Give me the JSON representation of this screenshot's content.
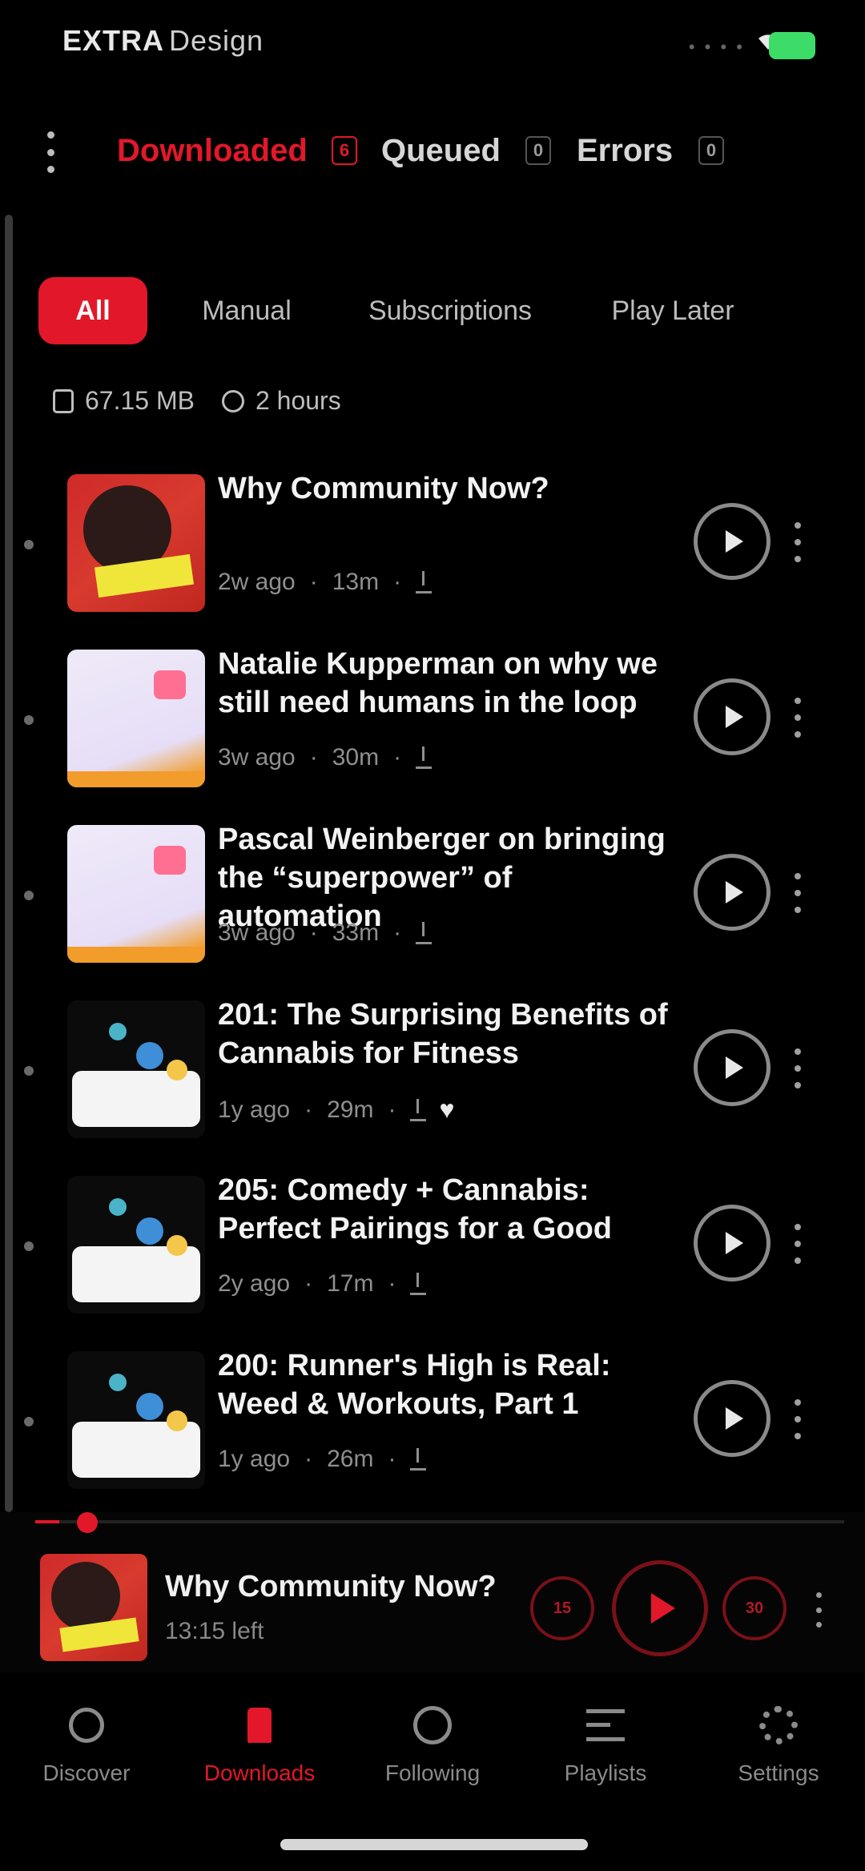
{
  "status_bar": {
    "carrier_bold": "EXTRA",
    "carrier_rest": "Design",
    "signal": "• • • •"
  },
  "top_tabs": [
    {
      "label": "Downloaded",
      "badge": "6",
      "active": true
    },
    {
      "label": "Queued",
      "badge": "0",
      "active": false
    },
    {
      "label": "Errors",
      "badge": "0",
      "active": false
    }
  ],
  "filters": [
    {
      "label": "All",
      "active": true
    },
    {
      "label": "Manual",
      "active": false
    },
    {
      "label": "Subscriptions",
      "active": false
    },
    {
      "label": "Play Later",
      "active": false
    }
  ],
  "summary": {
    "size": "67.15 MB",
    "duration": "2 hours"
  },
  "episodes": [
    {
      "title": "Why Community Now?",
      "age": "2w ago",
      "duration": "13m",
      "art": "red",
      "liked": false
    },
    {
      "title": "Natalie Kupperman on why we still need humans in the loop",
      "age": "3w ago",
      "duration": "30m",
      "art": "purple",
      "liked": false
    },
    {
      "title": "Pascal Weinberger on bringing the “superpower” of automation",
      "age": "3w ago",
      "duration": "33m",
      "art": "purple",
      "liked": false
    },
    {
      "title": "201: The Surprising Benefits of Cannabis for Fitness",
      "age": "1y ago",
      "duration": "29m",
      "art": "dark",
      "liked": true
    },
    {
      "title": "205: Comedy + Cannabis: Perfect Pairings for a Good",
      "age": "2y ago",
      "duration": "17m",
      "art": "dark",
      "liked": false
    },
    {
      "title": "200: Runner's High is Real: Weed & Workouts, Part 1",
      "age": "1y ago",
      "duration": "26m",
      "art": "dark",
      "liked": false
    }
  ],
  "mini_player": {
    "title": "Why Community Now?",
    "time": "13:15 left",
    "skip_back": "15",
    "skip_forward": "30",
    "progress": 0.03
  },
  "bottom_nav": [
    {
      "label": "Discover",
      "icon": "search-icon",
      "active": false
    },
    {
      "label": "Downloads",
      "icon": "download-icon",
      "active": true
    },
    {
      "label": "Following",
      "icon": "clock-icon",
      "active": false
    },
    {
      "label": "Playlists",
      "icon": "playlist-icon",
      "active": false
    },
    {
      "label": "Settings",
      "icon": "gear-icon",
      "active": false
    }
  ],
  "colors": {
    "accent": "#e2182a",
    "background": "#000000",
    "battery": "#3ddc68"
  }
}
